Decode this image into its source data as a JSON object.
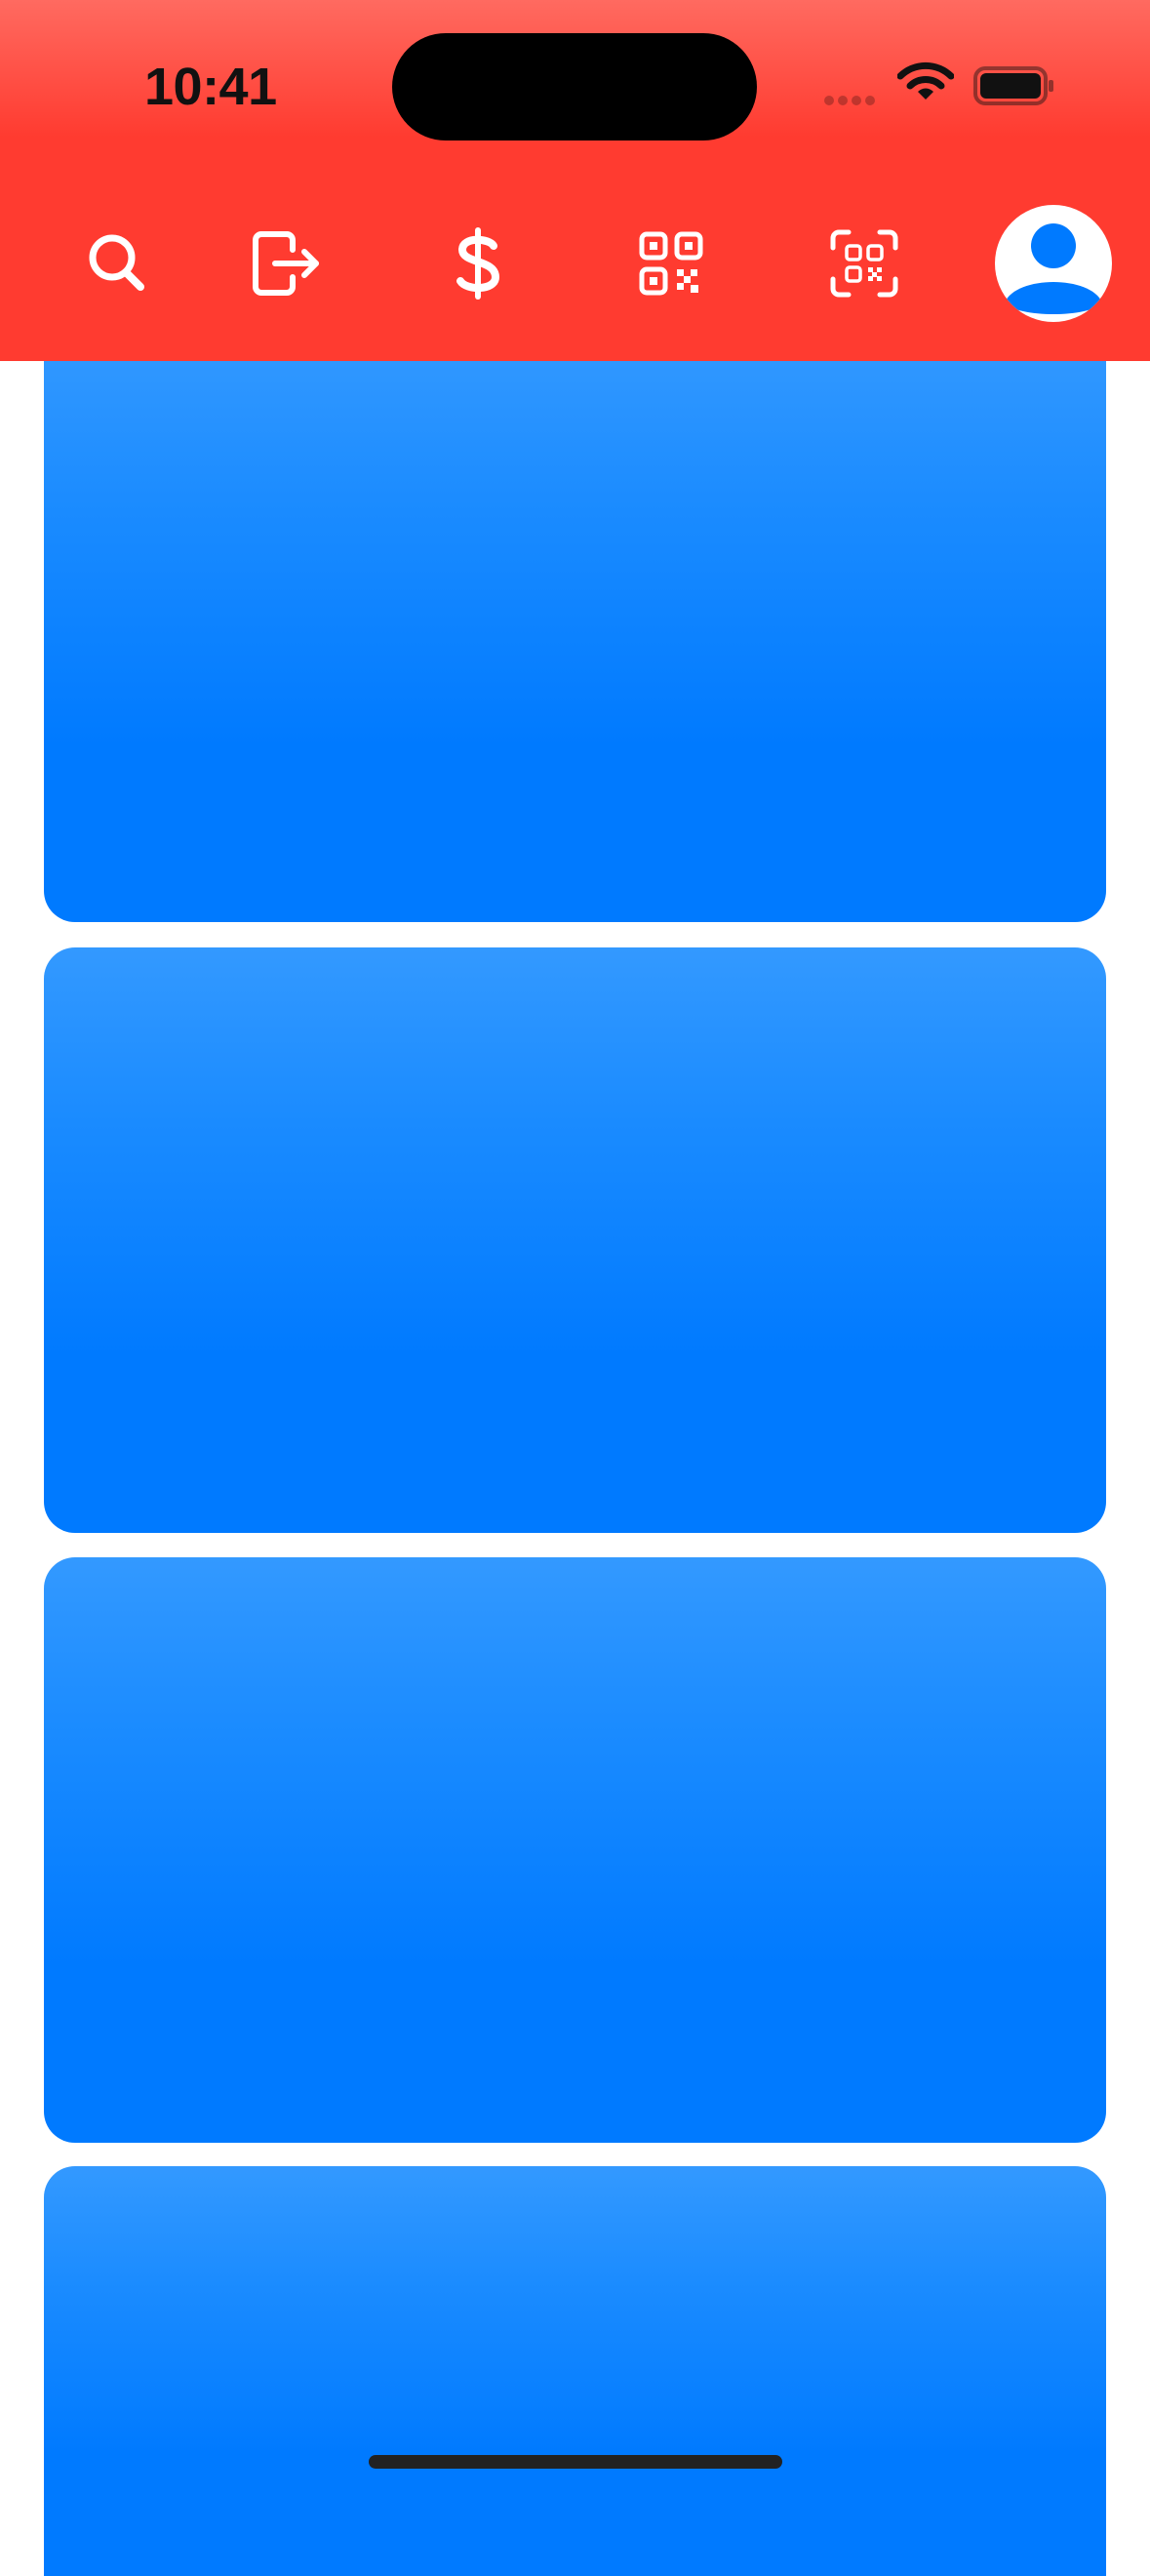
{
  "status_bar": {
    "time": "10:41"
  },
  "toolbar": {
    "icons": [
      "search-icon",
      "sign-out-icon",
      "dollar-icon",
      "qr-code-icon",
      "qr-scan-icon",
      "profile-avatar-icon"
    ]
  },
  "colors": {
    "toolbar_red": "#ff3b30",
    "card_blue": "#007aff",
    "background": "#ffffff"
  },
  "cards": [
    {
      "id": "card-1"
    },
    {
      "id": "card-2"
    },
    {
      "id": "card-3"
    },
    {
      "id": "card-4"
    }
  ]
}
